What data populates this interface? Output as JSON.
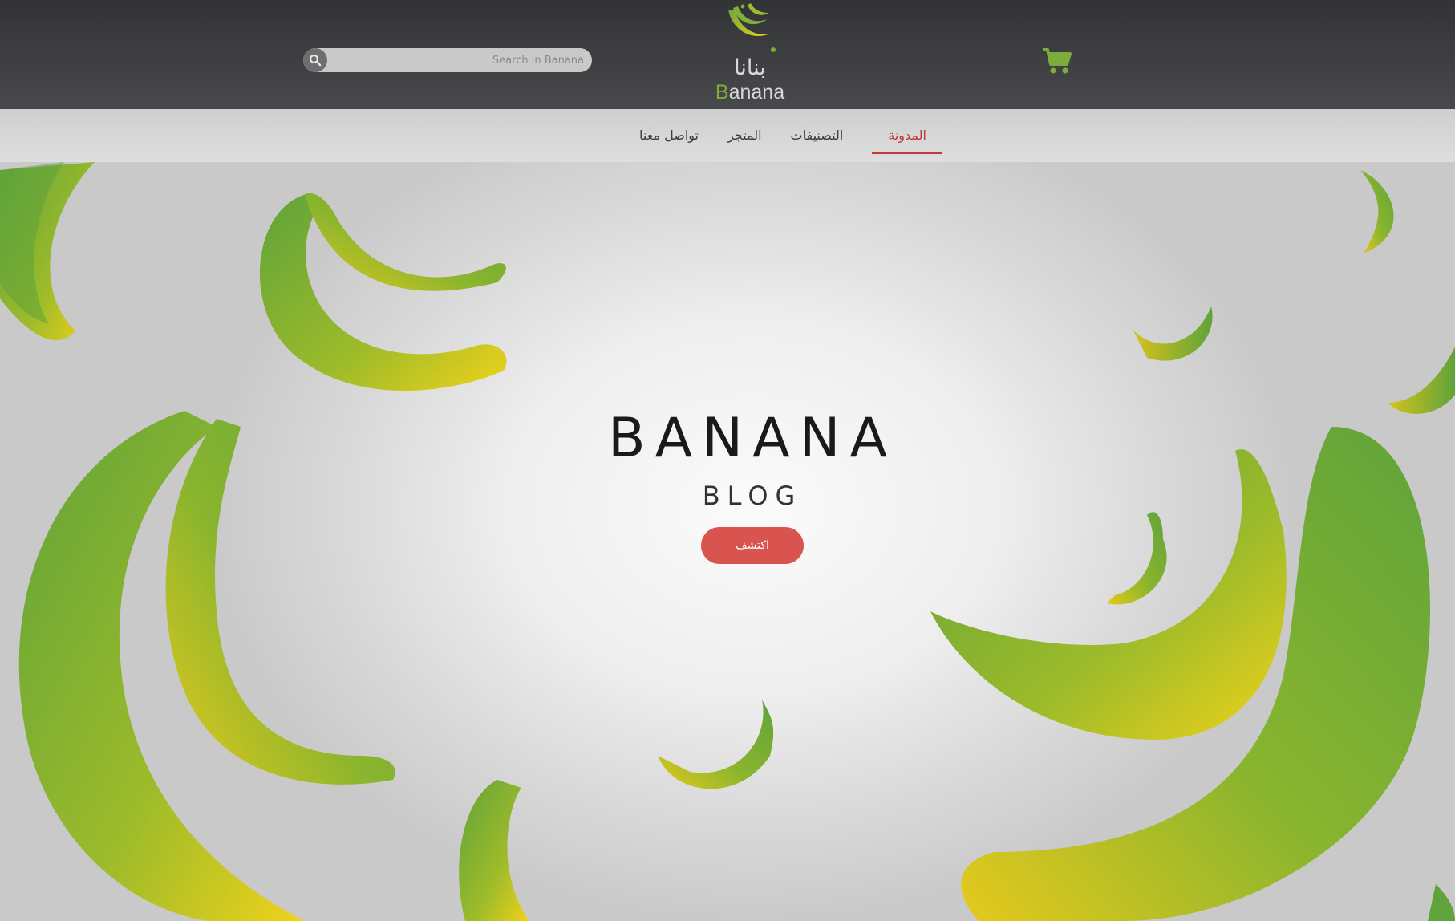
{
  "header": {
    "search": {
      "placeholder": "Search in Banana",
      "icon": "search-icon"
    },
    "logo": {
      "arabic": "بنانا",
      "english_initial": "B",
      "english_rest": "anana"
    },
    "cart": {
      "icon": "shopping-cart-icon"
    }
  },
  "nav": {
    "items": [
      {
        "label": "المدونة",
        "active": true
      },
      {
        "label": "التصنيفات",
        "active": false
      },
      {
        "label": "المتجر",
        "active": false
      },
      {
        "label": "تواصل معنا",
        "active": false
      }
    ]
  },
  "hero": {
    "title": "BANANA",
    "subtitle": "BLOG",
    "button_label": "اكتشف"
  },
  "colors": {
    "header_bg": "#3a3b3d",
    "nav_bg": "#d6d6d6",
    "accent_red": "#d9534f",
    "active_nav": "#c0393b",
    "brand_green": "#7dab3c",
    "banana_yellow": "#f0d21a"
  }
}
